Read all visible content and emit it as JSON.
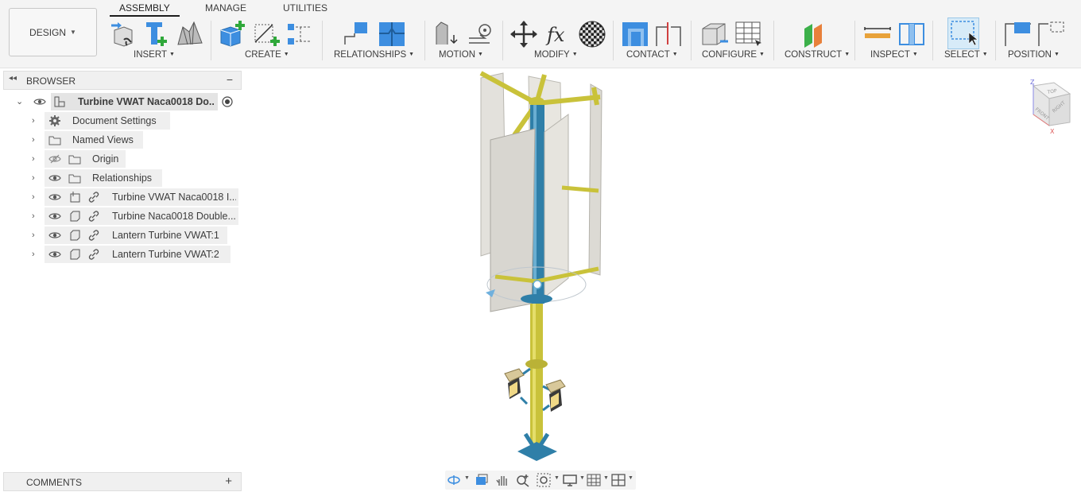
{
  "design_button": {
    "label": "DESIGN"
  },
  "tabs": [
    {
      "label": "ASSEMBLY",
      "active": true
    },
    {
      "label": "MANAGE"
    },
    {
      "label": "UTILITIES"
    }
  ],
  "toolbar_groups": [
    {
      "label": "INSERT"
    },
    {
      "label": "CREATE"
    },
    {
      "label": "RELATIONSHIPS"
    },
    {
      "label": "MOTION"
    },
    {
      "label": "MODIFY"
    },
    {
      "label": "CONTACT"
    },
    {
      "label": "CONFIGURE"
    },
    {
      "label": "CONSTRUCT"
    },
    {
      "label": "INSPECT"
    },
    {
      "label": "SELECT"
    },
    {
      "label": "POSITION"
    }
  ],
  "browser": {
    "title": "BROWSER",
    "root": {
      "label": "Turbine VWAT Naca0018 Do..."
    },
    "items": [
      {
        "label": "Document Settings",
        "icon": "gear-icon"
      },
      {
        "label": "Named Views",
        "icon": "folder-icon"
      },
      {
        "label": "Origin",
        "icon": "folder-icon",
        "hidden": true
      },
      {
        "label": "Relationships",
        "icon": "folder-icon"
      },
      {
        "label": "Turbine VWAT Naca0018 I...",
        "icon": "assembly-icon",
        "linked": true
      },
      {
        "label": "Turbine Naca0018 Double...",
        "icon": "component-icon",
        "linked": true
      },
      {
        "label": "Lantern Turbine VWAT:1",
        "icon": "component-icon",
        "linked": true
      },
      {
        "label": "Lantern Turbine VWAT:2",
        "icon": "component-icon",
        "linked": true
      }
    ]
  },
  "comments": {
    "title": "COMMENTS"
  },
  "viewcube": {
    "faces": [
      "TOP",
      "FRONT",
      "RIGHT"
    ],
    "axes": [
      "Z",
      "X"
    ]
  },
  "colors": {
    "accent_blue": "#3d8ee0",
    "model_yellow": "#c9c23a",
    "model_blue": "#2f7fa8",
    "blade": "#e6e4de"
  }
}
